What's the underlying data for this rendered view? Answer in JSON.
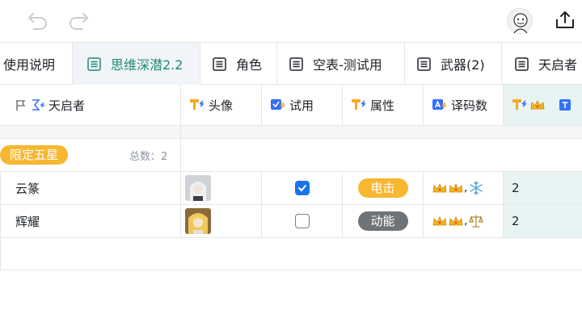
{
  "toolbar": {
    "undo_icon": "undo-icon",
    "redo_icon": "redo-icon",
    "avatar_icon": "user-avatar",
    "share_icon": "share-icon"
  },
  "tabs": [
    {
      "label": "使用说明",
      "active": false,
      "has_icon": false
    },
    {
      "label": "思维深潜2.2",
      "active": true,
      "has_icon": true
    },
    {
      "label": "角色",
      "active": false,
      "has_icon": true
    },
    {
      "label": "空表-测试用",
      "active": false,
      "has_icon": true
    },
    {
      "label": "武器(2)",
      "active": false,
      "has_icon": true
    },
    {
      "label": "天启者",
      "active": false,
      "has_icon": true
    }
  ],
  "columns": [
    {
      "label": "天启者",
      "icon": "primary-field-formula-icon"
    },
    {
      "label": "头像",
      "icon": "lookup-field-icon"
    },
    {
      "label": "试用",
      "icon": "checkbox-formula-icon"
    },
    {
      "label": "属性",
      "icon": "lookup-field-icon"
    },
    {
      "label": "译码数",
      "icon": "text-formula-icon"
    },
    {
      "label": "",
      "icon": "lookup-crown-icon"
    }
  ],
  "group": {
    "tag": "限定五星",
    "count_label": "总数：2",
    "tag_color": "#f7b731"
  },
  "rows": [
    {
      "name": "云篆",
      "trial": true,
      "attribute": "电击",
      "attribute_color": "#f7b731",
      "code": ",",
      "code_suffix_icon": "snowflake-icon",
      "count": "2"
    },
    {
      "name": "辉耀",
      "trial": false,
      "attribute": "动能",
      "attribute_color": "#6e7377",
      "code": ",",
      "code_suffix_icon": "scales-icon",
      "count": "2"
    }
  ],
  "colors": {
    "accent": "#1f8a7a",
    "highlight_col": "#e8f4f3",
    "checkbox": "#1a73e8"
  }
}
